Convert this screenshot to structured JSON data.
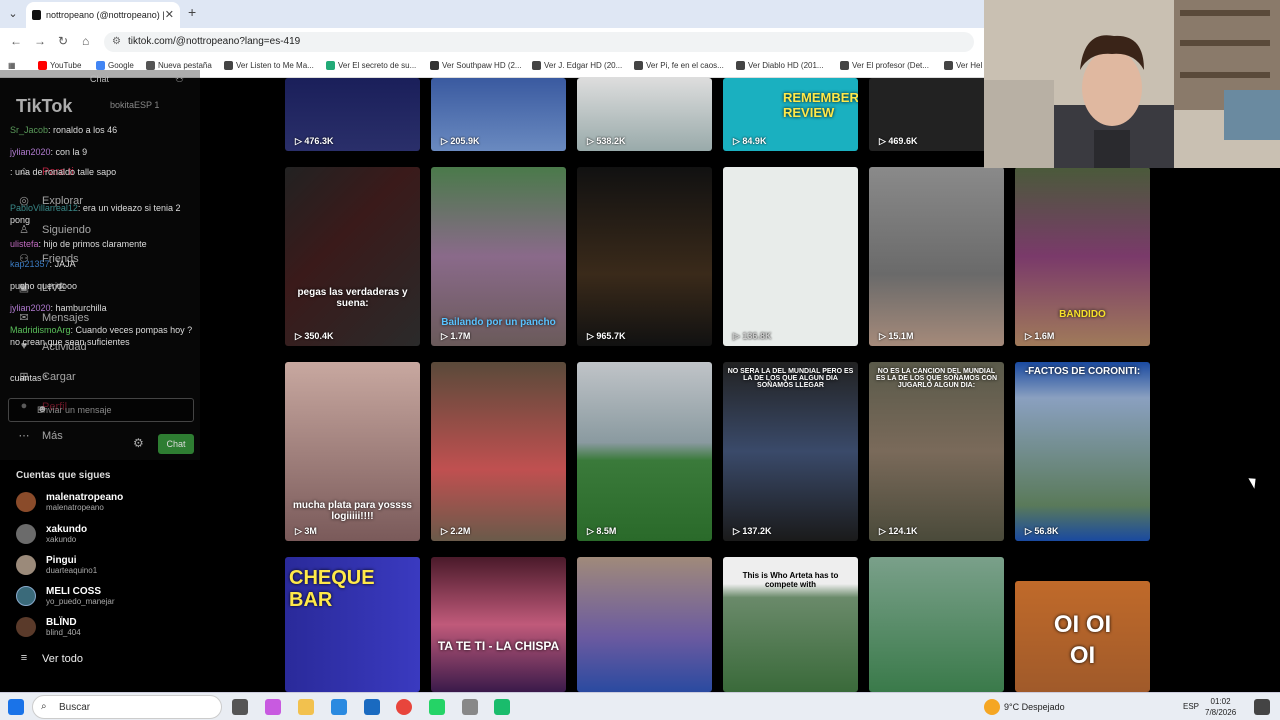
{
  "browser": {
    "tab_title": "nottropeano (@nottropeano) |",
    "url": "tiktok.com/@nottropeano?lang=es-419",
    "bookmarks": [
      "YouTube",
      "Google",
      "Nueva pestaña",
      "Ver Listen to Me Ma...",
      "Ver El secreto de su...",
      "Ver Southpaw HD (2...",
      "Ver J. Edgar HD (20...",
      "Ver Pi, fe en el caos...",
      "Ver Diablo HD (201...",
      "Ver El profesor (Det...",
      "Ver Hel"
    ]
  },
  "sidebar": {
    "logo": "TikTok",
    "nav": [
      {
        "label": "Para ti",
        "icon": "home-icon"
      },
      {
        "label": "Explorar",
        "icon": "compass-icon"
      },
      {
        "label": "Siguiendo",
        "icon": "following-icon"
      },
      {
        "label": "Friends",
        "icon": "friends-icon"
      },
      {
        "label": "LIVE",
        "icon": "live-icon"
      },
      {
        "label": "Mensajes",
        "icon": "messages-icon"
      },
      {
        "label": "Actividad",
        "icon": "activity-icon"
      },
      {
        "label": "Cargar",
        "icon": "upload-icon"
      },
      {
        "label": "Perfil",
        "icon": "profile-icon"
      },
      {
        "label": "Más",
        "icon": "more-icon"
      }
    ],
    "following_title": "Cuentas que sigues",
    "accounts": [
      {
        "name": "malenatropeano",
        "handle": "malenatropeano",
        "color": "#8a4b2a"
      },
      {
        "name": "xakundo",
        "handle": "xakundo",
        "color": "#6b6b6b"
      },
      {
        "name": "Pingui",
        "handle": "duarteaquino1",
        "color": "#9b8a7a"
      },
      {
        "name": "MELI COSS",
        "handle": "yo_puedo_manejar",
        "color": "#3a6a7a"
      },
      {
        "name": "BLÏND",
        "handle": "blind_404",
        "color": "#5a3a2a"
      }
    ],
    "see_all": "Ver todo"
  },
  "chat": {
    "title": "Chat",
    "channels": [
      "",
      "bokitaESP 1"
    ],
    "messages": [
      {
        "user": "Sr_Jacob",
        "text": "ronaldo a los 46"
      },
      {
        "user": "jylian2020",
        "text": "con la 9"
      },
      {
        "user": "",
        "text": ": una de ronaldo talle sapo"
      },
      {
        "user": "PabloVillarreal12",
        "text": "era un videazo si tenia 2 pong"
      },
      {
        "user": "ulistefa",
        "text": "hijo de primos claramente"
      },
      {
        "user": "kap21357",
        "text": "JAJA"
      },
      {
        "user": "",
        "text": "pucho queridooo"
      },
      {
        "user": "jylian2020",
        "text": "hamburchilla"
      },
      {
        "user": "MadridismoArg",
        "text": "Cuando veces pompas hoy ? no crean que sean suficientes"
      },
      {
        "user": "",
        "text": "cuantas *"
      }
    ],
    "input_placeholder": "Enviar un mensaje",
    "send_label": "Chat"
  },
  "videos": [
    {
      "views": "476.3K"
    },
    {
      "views": "205.9K"
    },
    {
      "views": "538.2K"
    },
    {
      "views": "84.9K",
      "caption": "REMEMBER REVIEW"
    },
    {
      "views": "469.6K"
    },
    {
      "views": "350.4K",
      "caption": "pegas las verdaderas y suena:"
    },
    {
      "views": "1.7M",
      "caption": "Bailando por un pancho"
    },
    {
      "views": "965.7K"
    },
    {
      "views": "136.8K"
    },
    {
      "views": "15.1M"
    },
    {
      "views": "1.6M",
      "caption": "BANDIDO"
    },
    {
      "views": "3M",
      "caption": "mucha plata para yossss logiiiii!!!!"
    },
    {
      "views": "2.2M"
    },
    {
      "views": "8.5M"
    },
    {
      "views": "137.2K",
      "caption": "NO SERA LA DEL MUNDIAL PERO ES LA DE LOS QUE ALGUN DIA SOÑAMOS LLEGAR"
    },
    {
      "views": "124.1K",
      "caption": "NO ES LA CANCION DEL MUNDIAL ES LA DE LOS QUE SOÑAMOS CON JUGARLO ALGUN DIA:"
    },
    {
      "views": "56.8K",
      "caption": "-FACTOS DE CORONITI:"
    },
    {
      "views": "",
      "caption": "CHEQUE BAR"
    },
    {
      "views": "",
      "caption": "TA TE TI - LA CHISPA"
    },
    {
      "views": ""
    },
    {
      "views": "",
      "caption": "This is Who Arteta has to compete with"
    },
    {
      "views": ""
    },
    {
      "views": "",
      "caption": "OI OI OI"
    }
  ],
  "taskbar": {
    "search": "Buscar",
    "weather": "9°C  Despejado",
    "lang": "ESP",
    "time": "01:02",
    "date": "7/8/2026"
  }
}
